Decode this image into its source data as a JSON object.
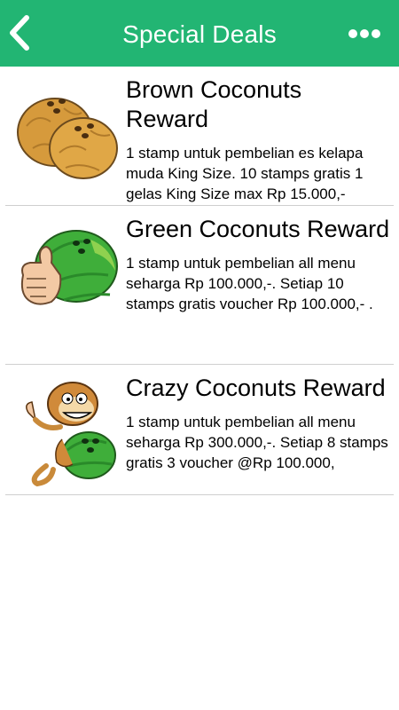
{
  "header": {
    "title": "Special Deals",
    "back_icon": "chevron-left-icon",
    "more_icon": "more-dots-icon",
    "bar_color": "#22b573"
  },
  "deals": [
    {
      "title": "Brown Coconuts Reward",
      "description": "1 stamp untuk pembelian es kelapa muda King Size. 10 stamps gratis 1 gelas King Size max Rp 15.000,-",
      "image": "brown-coconuts-image"
    },
    {
      "title": "Green Coconuts Reward",
      "description": "1 stamp untuk pembelian all menu seharga Rp 100.000,-. Setiap 10 stamps gratis voucher Rp 100.000,- .",
      "image": "green-coconut-thumbs-up-image"
    },
    {
      "title": "Crazy Coconuts Reward",
      "description": "1 stamp untuk pembelian all menu seharga Rp 300.000,-. Setiap 8 stamps gratis 3 voucher @Rp 100.000,",
      "image": "monkey-green-coconut-image"
    }
  ]
}
